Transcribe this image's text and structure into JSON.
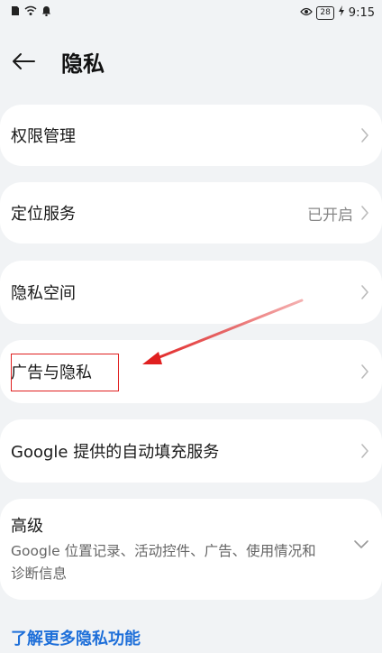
{
  "status_bar": {
    "battery": "28",
    "time": "9:15"
  },
  "header": {
    "title": "隐私"
  },
  "items": [
    {
      "label": "权限管理",
      "value": ""
    },
    {
      "label": "定位服务",
      "value": "已开启"
    },
    {
      "label": "隐私空间",
      "value": ""
    },
    {
      "label": "广告与隐私",
      "value": ""
    },
    {
      "label": "Google 提供的自动填充服务",
      "value": ""
    }
  ],
  "advanced": {
    "title": "高级",
    "description": "Google 位置记录、活动控件、广告、使用情况和诊断信息"
  },
  "learn_more": "了解更多隐私功能",
  "colors": {
    "background": "#f1f3f5",
    "link": "#1e6fd9",
    "annotation": "#e02020"
  }
}
